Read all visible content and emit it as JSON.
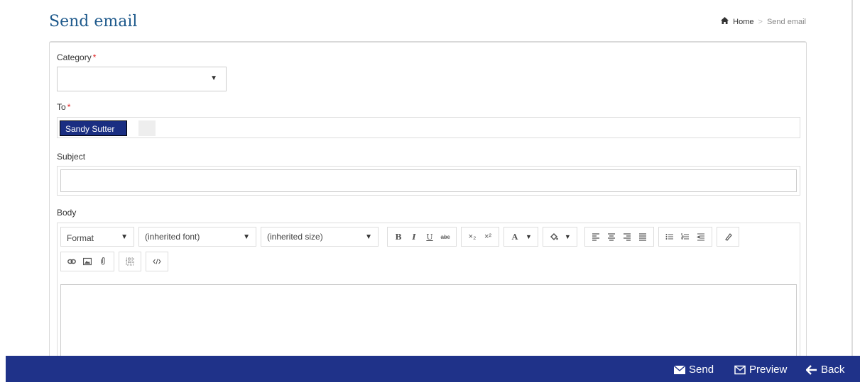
{
  "page": {
    "title": "Send email"
  },
  "breadcrumb": {
    "home": "Home",
    "separator": ">",
    "current": "Send email"
  },
  "form": {
    "category": {
      "label": "Category",
      "required_mark": "*",
      "value": ""
    },
    "to": {
      "label": "To",
      "required_mark": "*",
      "recipients": [
        "Sandy Sutter"
      ],
      "remove_glyph": "×"
    },
    "subject": {
      "label": "Subject",
      "value": ""
    },
    "body": {
      "label": "Body",
      "value": ""
    }
  },
  "toolbar": {
    "format": "Format",
    "font": "(inherited font)",
    "size": "(inherited size)",
    "bold": "B",
    "italic": "I",
    "underline": "U",
    "strike": "abc",
    "subscript": "×₂",
    "superscript": "×²",
    "text_color": "A"
  },
  "footer": {
    "send": "Send",
    "preview": "Preview",
    "back": "Back"
  },
  "colors": {
    "title": "#1f5a8c",
    "footer_bg": "#1f3289",
    "chip_bg": "#1a2e82",
    "required": "#e02020"
  },
  "icons": [
    "home-icon",
    "envelope-icon",
    "envelope-outline-icon",
    "arrow-left-icon"
  ]
}
